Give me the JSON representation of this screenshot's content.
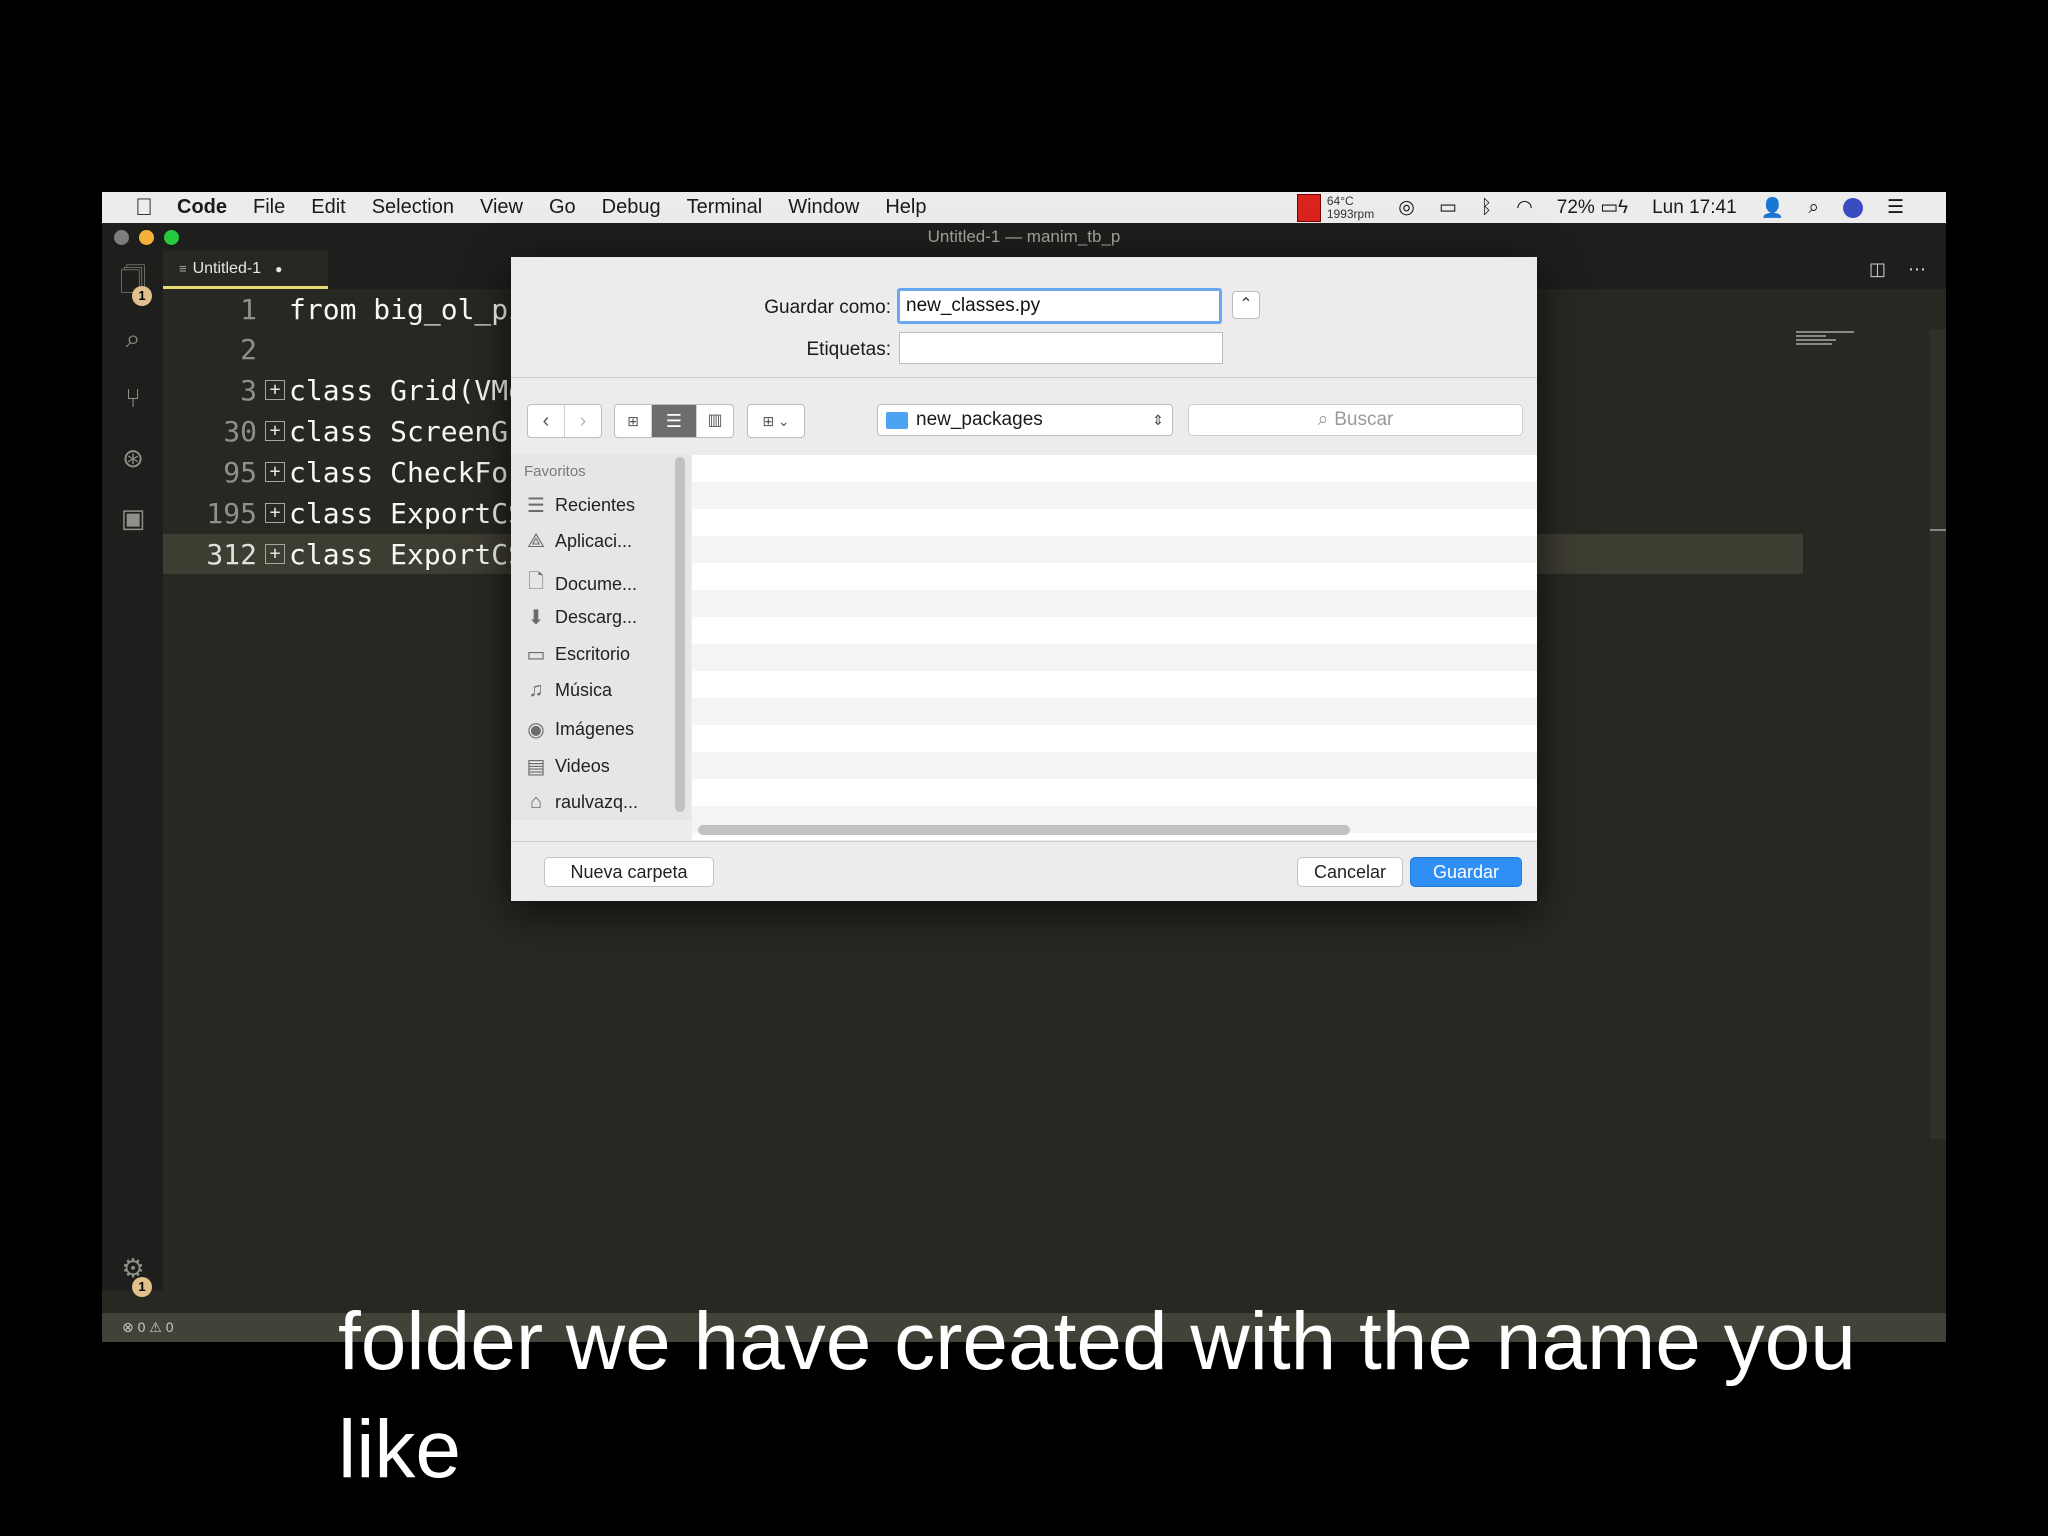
{
  "menubar": {
    "apple_icon": "apple-logo",
    "app_name": "Code",
    "items": [
      "File",
      "Edit",
      "Selection",
      "View",
      "Go",
      "Debug",
      "Terminal",
      "Window",
      "Help"
    ],
    "temp": "64°C",
    "fan": "1993rpm",
    "battery": "72%",
    "clock": "Lun 17:41"
  },
  "window": {
    "title": "Untitled-1 — manim_tb_p",
    "traffic_colors": [
      "#7d7d7d",
      "#f5b23b",
      "#27c93f"
    ]
  },
  "tab": {
    "label": "Untitled-1",
    "dirty_marker": "●"
  },
  "activity": {
    "explorer_badge": "1",
    "settings_badge": "1"
  },
  "editor": {
    "lines": [
      {
        "num": "1",
        "text": "from big_ol_pi",
        "fold": ""
      },
      {
        "num": "2",
        "text": "",
        "fold": ""
      },
      {
        "num": "3",
        "text": "class Grid(VMo",
        "fold": "+"
      },
      {
        "num": "30",
        "text": "class ScreenGr",
        "fold": "+"
      },
      {
        "num": "95",
        "text": "class CheckFor",
        "fold": "+"
      },
      {
        "num": "195",
        "text": "class ExportCS",
        "fold": "+"
      },
      {
        "num": "312",
        "text": "class ExportCS",
        "fold": "+"
      }
    ]
  },
  "statusbar": {
    "problems": "⊗ 0 ⚠ 0"
  },
  "dialog": {
    "save_as_label": "Guardar como:",
    "filename": "new_classes.py",
    "tags_label": "Etiquetas:",
    "tags_value": "",
    "location": "new_packages",
    "search_placeholder": "Buscar",
    "sidebar_heading": "Favoritos",
    "sidebar_items": [
      {
        "label": "Recientes",
        "icon": "☰"
      },
      {
        "label": "Aplicaci...",
        "icon": "⟁"
      },
      {
        "label": "Docume...",
        "icon": "🗋"
      },
      {
        "label": "Descarg...",
        "icon": "⬇"
      },
      {
        "label": "Escritorio",
        "icon": "▭"
      },
      {
        "label": "Música",
        "icon": "♫"
      },
      {
        "label": "Imágenes",
        "icon": "◉"
      },
      {
        "label": "Videos",
        "icon": "▤"
      },
      {
        "label": "raulvazq...",
        "icon": "⌂"
      }
    ],
    "new_folder_label": "Nueva carpeta",
    "cancel_label": "Cancelar",
    "save_label": "Guardar"
  },
  "caption": {
    "line1": "folder we have created with the name you",
    "line2": "like"
  }
}
